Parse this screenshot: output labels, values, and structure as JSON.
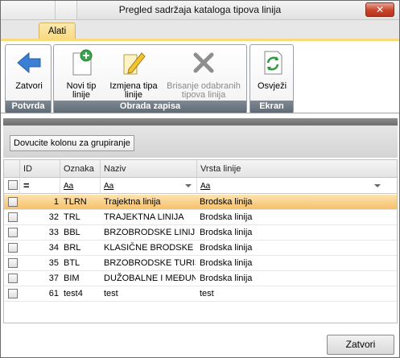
{
  "window": {
    "title": "Pregled sadržaja kataloga tipova linija",
    "close_glyph": "✕"
  },
  "ribbon": {
    "tab": "Alati",
    "groups": {
      "potvrda": {
        "label": "Potvrda",
        "zatvori": "Zatvori"
      },
      "obrada": {
        "label": "Obrada zapisa",
        "novi_l1": "Novi tip",
        "novi_l2": "linije",
        "izmjena_l1": "Izmjena tipa",
        "izmjena_l2": "linije",
        "brisanje_l1": "Brisanje odabranih",
        "brisanje_l2": "tipova linija"
      },
      "ekran": {
        "label": "Ekran",
        "osvjezi": "Osvježi"
      }
    }
  },
  "grid": {
    "group_panel_text": "Dovucite kolonu za grupiranje",
    "columns": {
      "id": "ID",
      "oznaka": "Oznaka",
      "naziv": "Naziv",
      "vrsta": "Vrsta linije"
    },
    "filter": {
      "id_op": "=",
      "aa": "Aa"
    },
    "rows": [
      {
        "id": "1",
        "oznaka": "TLRN",
        "naziv": "Trajektna linija",
        "vrsta": "Brodska linija"
      },
      {
        "id": "32",
        "oznaka": "TRL",
        "naziv": "TRAJEKTNA LINIJA",
        "vrsta": "Brodska linija"
      },
      {
        "id": "33",
        "oznaka": "BBL",
        "naziv": "BRZOBRODSKE LINIJE",
        "vrsta": "Brodska linija"
      },
      {
        "id": "34",
        "oznaka": "BRL",
        "naziv": "KLASIČNE BRODSKE LI",
        "vrsta": "Brodska linija"
      },
      {
        "id": "35",
        "oznaka": "BTL",
        "naziv": "BRZOBRODSKE TURIST",
        "vrsta": "Brodska linija"
      },
      {
        "id": "37",
        "oznaka": "BIM",
        "naziv": "DUŽOBALNE I MEĐUNA",
        "vrsta": "Brodska linija"
      },
      {
        "id": "61",
        "oznaka": "test4",
        "naziv": "test",
        "vrsta": "test"
      }
    ]
  },
  "footer": {
    "close_button": "Zatvori"
  },
  "colors": {
    "selected_row": "#f6c16a",
    "tab_accent": "#f8d97c",
    "group_label_bg": "#6a747e"
  }
}
